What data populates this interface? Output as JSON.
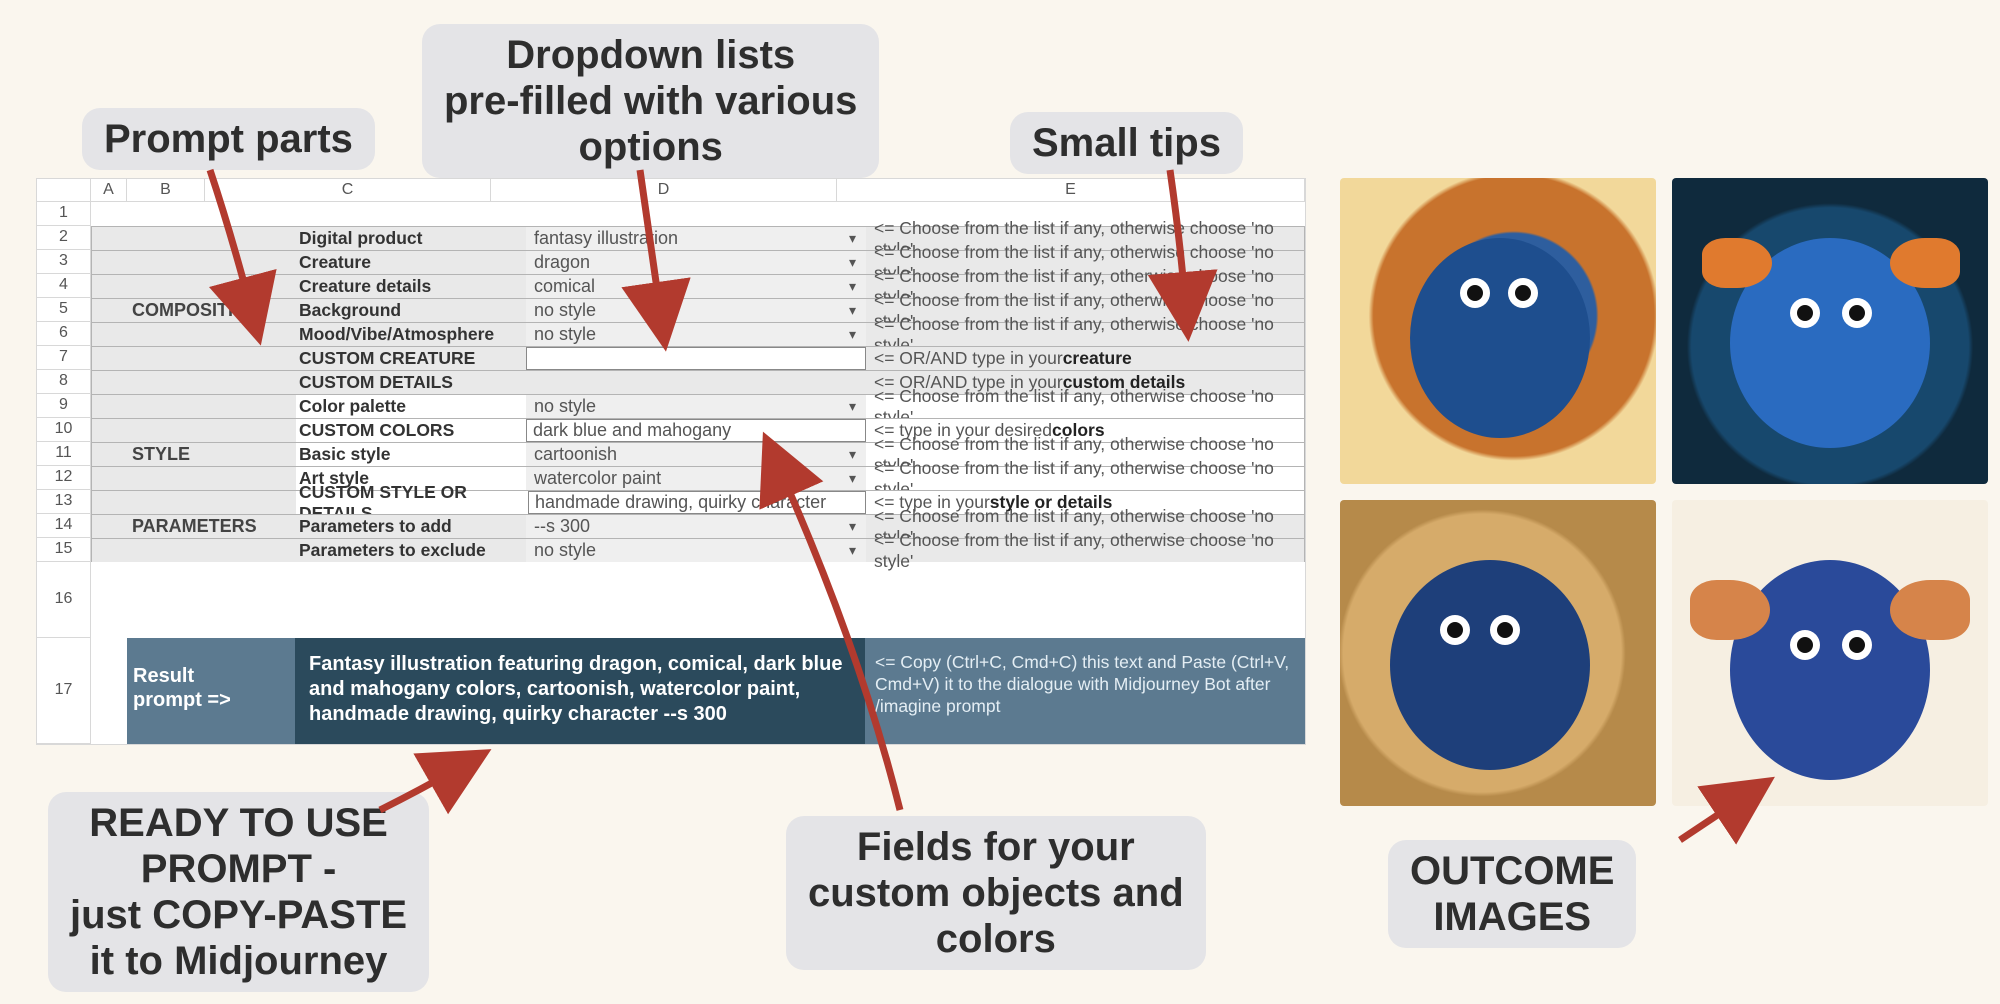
{
  "callouts": {
    "prompt_parts": "Prompt parts",
    "dropdowns": "Dropdown lists\npre-filled with various\noptions",
    "small_tips": "Small tips",
    "custom_fields": "Fields for your\ncustom objects and\ncolors",
    "ready_prompt": "READY TO USE\nPROMPT -\njust COPY-PASTE\nit to Midjourney",
    "outcome": "OUTCOME\nIMAGES"
  },
  "columns": [
    "A",
    "B",
    "C",
    "D",
    "E"
  ],
  "rows": [
    "1",
    "2",
    "3",
    "4",
    "5",
    "6",
    "7",
    "8",
    "9",
    "10",
    "11",
    "12",
    "13",
    "14",
    "15",
    "16",
    "17"
  ],
  "sections": {
    "composition": "COMPOSITION",
    "style": "STYLE",
    "parameters": "PARAMETERS"
  },
  "labels": {
    "digital_product": "Digital product",
    "creature": "Creature",
    "creature_details": "Creature details",
    "background": "Background",
    "mood": "Mood/Vibe/Atmosphere",
    "custom_creature": "CUSTOM CREATURE",
    "custom_details": "CUSTOM DETAILS",
    "color_palette": "Color palette",
    "custom_colors": "CUSTOM COLORS",
    "basic_style": "Basic style",
    "art_style": "Art style",
    "custom_style": "CUSTOM STYLE OR DETAILS",
    "params_add": "Parameters to add",
    "params_exclude": "Parameters to exclude"
  },
  "values": {
    "digital_product": "fantasy illustration",
    "creature": "dragon",
    "creature_details": "comical",
    "background": "no style",
    "mood": "no style",
    "custom_creature": "",
    "custom_details": "",
    "color_palette": "no style",
    "custom_colors": "dark blue and mahogany",
    "basic_style": "cartoonish",
    "art_style": "watercolor paint",
    "custom_style": "handmade drawing, quirky character",
    "params_add": "--s 300",
    "params_exclude": "no style"
  },
  "tips": {
    "choose_list": "<= Choose from the list if any, otherwise choose 'no style'",
    "or_creature_pre": "<= OR/AND type in your ",
    "or_creature_b": "creature",
    "or_details_pre": "<= OR/AND type in your ",
    "or_details_b": "custom details",
    "colors_pre": "<= type in your desired ",
    "colors_b": "colors",
    "style_pre": "<= type in your ",
    "style_b": "style or details"
  },
  "result": {
    "label": "Result\nprompt =>",
    "text": "Fantasy illustration featuring dragon, comical, dark blue and mahogany colors, cartoonish, watercolor paint, handmade drawing, quirky character --s 300",
    "hint": "<= Copy (Ctrl+C, Cmd+C) this text and Paste (Ctrl+V, Cmd+V) it to the dialogue with Midjourney Bot after /imagine prompt"
  }
}
